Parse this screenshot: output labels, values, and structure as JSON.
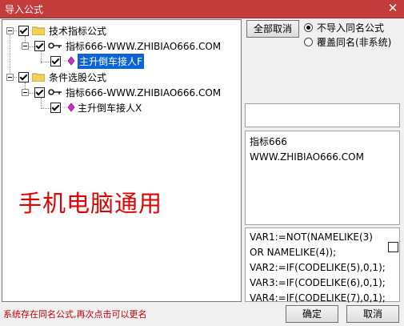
{
  "window": {
    "title": "导入公式",
    "close_glyph": "✕"
  },
  "tree": {
    "groups": [
      {
        "label": "技术指标公式",
        "child": {
          "label": "指标666-WWW.ZHIBIAO666.COM",
          "leaf": "主升倒车接人F"
        }
      },
      {
        "label": "条件选股公式",
        "child": {
          "label": "指标666-WWW.ZHIBIAO666.COM",
          "leaf": "主升倒车接人X"
        }
      }
    ]
  },
  "toolbar": {
    "cancel_all_label": "全部取消"
  },
  "options": {
    "no_import_same_label": "不导入同名公式",
    "overwrite_label": "覆盖同名(非系统)",
    "selected": "no_import_same"
  },
  "description": {
    "line1": "指标666",
    "line2": "WWW.ZHIBIAO666.COM"
  },
  "code": {
    "lines": [
      "VAR1:=NOT(NAMELIKE(3)",
      "OR NAMELIKE(4));",
      "VAR2:=IF(CODELIKE(5),0,1);",
      "VAR3:=IF(CODELIKE(6),0,1);",
      "VAR4:=IF(CODELIKE(7),0,1);"
    ]
  },
  "watermark": "手机电脑通用",
  "status": "系统存在同名公式,再次点击可以更名",
  "buttons": {
    "ok_label": "确定",
    "cancel_label": "取消"
  },
  "colors": {
    "title_bar": "#c33b3b",
    "selection": "#0a64d8",
    "watermark": "#e00000",
    "status": "#c00000"
  }
}
